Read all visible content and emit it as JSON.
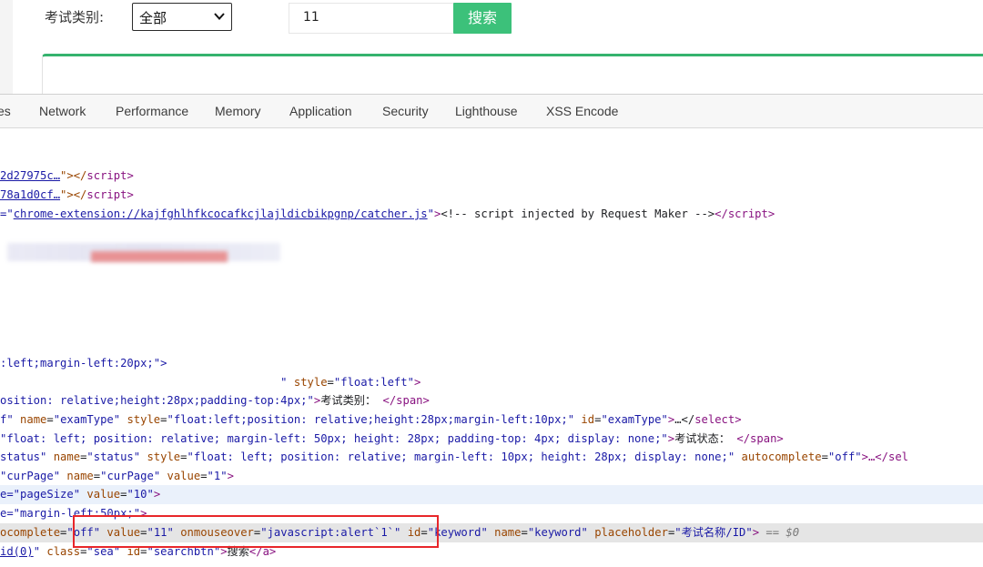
{
  "filter": {
    "type_label": "考试类别:",
    "type_selected": "全部",
    "keyword_value": "11",
    "search_label": "搜索"
  },
  "devtools_tabs": [
    "es",
    "Network",
    "Performance",
    "Memory",
    "Application",
    "Security",
    "Lighthouse",
    "XSS Encode"
  ],
  "code_lines": {
    "l1_a": "2d27975c…",
    "l1_b": "\"></",
    "l1_c": "script",
    "l1_d": ">",
    "l2_a": "78a1d0cf…",
    "l3_a": "=\"",
    "l3_link": "chrome-extension://kajfghlhfkcocafkcjlajldicbikpgnp/catcher.js",
    "l3_comment": "<!-- script injected by Request Maker -->",
    "l4": ":left;margin-left:20px;\">",
    "l5_attr": "style",
    "l5_val": "float:left",
    "l6_val": "osition: relative;height:28px;padding-top:4px;",
    "l6_text": "考试类别：",
    "l7_a": "f\"",
    "l7_name_val": "examType",
    "l7_style_val": "float:left;position: relative;height:28px;margin-left:10px;",
    "l7_id_val": "examType",
    "l7_tail": "…</",
    "l8_a": "\"float: left; position: relative; margin-left: 50px; height: 28px; padding-top: 4px; display: none;",
    "l8_text": "考试状态：",
    "l9_a": "status",
    "l9_name_val": "status",
    "l9_style_val": "float: left; position: relative; margin-left: 10px; height: 28px; display: none;",
    "l9_ac_val": "off",
    "l9_tail": "…</sel",
    "l10_a": "curPage",
    "l10_name_val": "curPage",
    "l10_value_val": "1",
    "l11_a": "pageSize",
    "l11_value_val": "10",
    "l12_a": "margin-left:50px;",
    "l13_ac": "ocomplete",
    "l13_ac_val": "off",
    "l13_value_val": "11",
    "l13_mouse_attr": "onmouseover",
    "l13_mouse_val": "javascript:alert`1`",
    "l13_id_val": "keyword",
    "l13_name_val": "keyword",
    "l13_ph_val": "考试名称/ID",
    "l13_eq": "== $0",
    "l14_a": "id(0)",
    "l14_class_val": "sea",
    "l14_id_val": "searchbtn",
    "l14_text": "搜索"
  }
}
